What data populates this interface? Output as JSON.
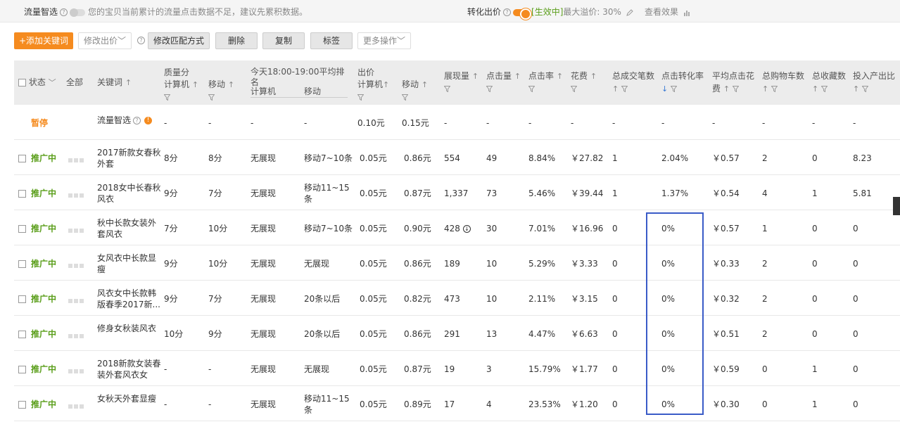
{
  "topbar": {
    "smart_label": "流量智选",
    "smart_notice": "您的宝贝当前累计的流量点击数据不足，建议先累积数据。",
    "conv_label": "转化出价",
    "conv_status": "[生效中]",
    "conv_premium": "最大溢价: 30%",
    "view_effect": "查看效果"
  },
  "toolbar": {
    "add": "+添加关键词",
    "modify_bid": "修改出价",
    "modify_match": "修改匹配方式",
    "delete": "删除",
    "copy": "复制",
    "tag": "标签",
    "more": "更多操作"
  },
  "header": {
    "status": "状态",
    "all": "全部",
    "keyword": "关键词",
    "quality": "质量分",
    "pc": "计算机",
    "mobile": "移动",
    "rank": "今天18:00-19:00平均排名",
    "bid": "出价",
    "impressions": "展现量",
    "clicks": "点击量",
    "ctr": "点击率",
    "cost": "花费",
    "orders": "总成交笔数",
    "cvr": "点击转化率",
    "cpc_1": "平均点击花",
    "cpc_2": "费",
    "cart": "总购物车数",
    "fav": "总收藏数",
    "roi": "投入产出比"
  },
  "rows": [
    {
      "status": "暂停",
      "keyword": "流量智选",
      "q_pc": "-",
      "q_mob": "-",
      "r_pc": "-",
      "r_mob": "-",
      "b_pc": "0.10元",
      "b_mob": "0.15元",
      "imp": "-",
      "clk": "-",
      "ctr": "-",
      "cost": "-",
      "ord": "-",
      "cvr": "-",
      "cpc": "-",
      "cart": "-",
      "fav": "-",
      "roi": "-"
    },
    {
      "status": "推广中",
      "keyword": "2017新款女春秋外套",
      "q_pc": "8分",
      "q_mob": "8分",
      "r_pc": "无展现",
      "r_mob": "移动7~10条",
      "b_pc": "0.05元",
      "b_mob": "0.86元",
      "imp": "554",
      "clk": "49",
      "ctr": "8.84%",
      "cost": "￥27.82",
      "ord": "1",
      "cvr": "2.04%",
      "cpc": "￥0.57",
      "cart": "2",
      "fav": "0",
      "roi": "8.23"
    },
    {
      "status": "推广中",
      "keyword": "2018女中长春秋风衣",
      "q_pc": "9分",
      "q_mob": "7分",
      "r_pc": "无展现",
      "r_mob": "移动11~15条",
      "b_pc": "0.05元",
      "b_mob": "0.87元",
      "imp": "1,337",
      "clk": "73",
      "ctr": "5.46%",
      "cost": "￥39.44",
      "ord": "1",
      "cvr": "1.37%",
      "cpc": "￥0.54",
      "cart": "4",
      "fav": "1",
      "roi": "5.81"
    },
    {
      "status": "推广中",
      "keyword": "秋中长款女装外套风衣",
      "q_pc": "7分",
      "q_mob": "10分",
      "r_pc": "无展现",
      "r_mob": "移动7~10条",
      "b_pc": "0.05元",
      "b_mob": "0.90元",
      "imp": "428",
      "clk": "30",
      "ctr": "7.01%",
      "cost": "￥16.96",
      "ord": "0",
      "cvr": "0%",
      "cpc": "￥0.57",
      "cart": "1",
      "fav": "0",
      "roi": "0"
    },
    {
      "status": "推广中",
      "keyword": "女风衣中长款显瘦",
      "q_pc": "9分",
      "q_mob": "10分",
      "r_pc": "无展现",
      "r_mob": "无展现",
      "b_pc": "0.05元",
      "b_mob": "0.86元",
      "imp": "189",
      "clk": "10",
      "ctr": "5.29%",
      "cost": "￥3.33",
      "ord": "0",
      "cvr": "0%",
      "cpc": "￥0.33",
      "cart": "2",
      "fav": "0",
      "roi": "0"
    },
    {
      "status": "推广中",
      "keyword": "风衣女中长款韩版春季2017新...",
      "q_pc": "9分",
      "q_mob": "7分",
      "r_pc": "无展现",
      "r_mob": "20条以后",
      "b_pc": "0.05元",
      "b_mob": "0.82元",
      "imp": "473",
      "clk": "10",
      "ctr": "2.11%",
      "cost": "￥3.15",
      "ord": "0",
      "cvr": "0%",
      "cpc": "￥0.32",
      "cart": "2",
      "fav": "0",
      "roi": "0"
    },
    {
      "status": "推广中",
      "keyword": "修身女秋装风衣",
      "q_pc": "10分",
      "q_mob": "9分",
      "r_pc": "无展现",
      "r_mob": "20条以后",
      "b_pc": "0.05元",
      "b_mob": "0.86元",
      "imp": "291",
      "clk": "13",
      "ctr": "4.47%",
      "cost": "￥6.63",
      "ord": "0",
      "cvr": "0%",
      "cpc": "￥0.51",
      "cart": "2",
      "fav": "0",
      "roi": "0"
    },
    {
      "status": "推广中",
      "keyword": "2018新款女装春装外套风衣女",
      "q_pc": "-",
      "q_mob": "-",
      "r_pc": "无展现",
      "r_mob": "无展现",
      "b_pc": "0.05元",
      "b_mob": "0.87元",
      "imp": "19",
      "clk": "3",
      "ctr": "15.79%",
      "cost": "￥1.77",
      "ord": "0",
      "cvr": "0%",
      "cpc": "￥0.59",
      "cart": "0",
      "fav": "1",
      "roi": "0"
    },
    {
      "status": "推广中",
      "keyword": "女秋天外套显瘦",
      "q_pc": "-",
      "q_mob": "-",
      "r_pc": "无展现",
      "r_mob": "移动11~15条",
      "b_pc": "0.05元",
      "b_mob": "0.89元",
      "imp": "17",
      "clk": "4",
      "ctr": "23.53%",
      "cost": "￥1.20",
      "ord": "0",
      "cvr": "0%",
      "cpc": "￥0.30",
      "cart": "0",
      "fav": "1",
      "roi": "0"
    }
  ]
}
